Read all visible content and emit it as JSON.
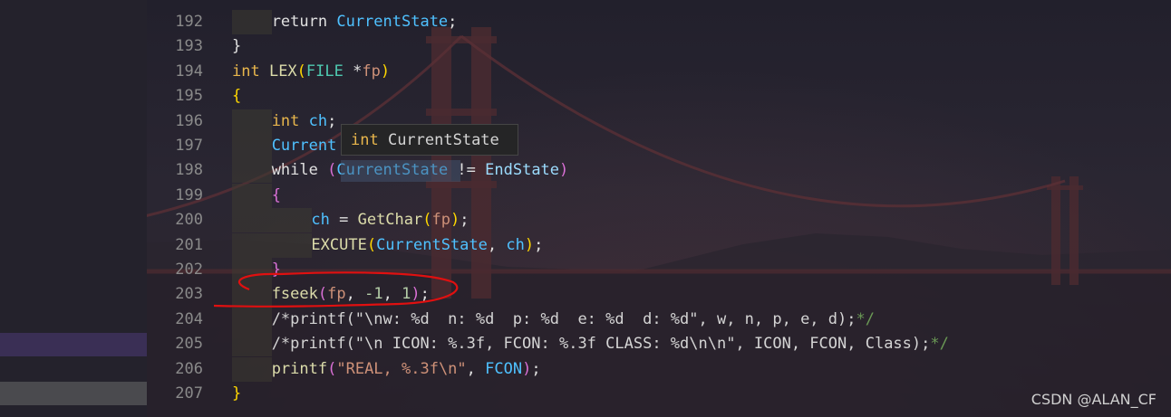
{
  "editor": {
    "lines": [
      {
        "num": "192",
        "tokens": [
          {
            "t": "return ",
            "c": "ctl"
          },
          {
            "t": "CurrentState",
            "c": "var"
          },
          {
            "t": ";",
            "c": "ctl"
          }
        ]
      },
      {
        "num": "193",
        "tokens": [
          {
            "t": "}",
            "c": "ctl"
          }
        ]
      },
      {
        "num": "194",
        "tokens": [
          {
            "t": "int ",
            "c": "kw"
          },
          {
            "t": "LEX",
            "c": "fn"
          },
          {
            "t": "(",
            "c": "yellow"
          },
          {
            "t": "FILE ",
            "c": "type"
          },
          {
            "t": "*",
            "c": "ctl"
          },
          {
            "t": "fp",
            "c": "str"
          },
          {
            "t": ")",
            "c": "yellow"
          }
        ]
      },
      {
        "num": "195",
        "tokens": [
          {
            "t": "{",
            "c": "yellow"
          }
        ]
      },
      {
        "num": "196",
        "tokens": [
          {
            "t": "int ",
            "c": "kw"
          },
          {
            "t": "ch",
            "c": "var"
          },
          {
            "t": ";",
            "c": "ctl"
          }
        ]
      },
      {
        "num": "197",
        "tokens": [
          {
            "t": "Current",
            "c": "var"
          }
        ]
      },
      {
        "num": "198",
        "tokens": [
          {
            "t": "while ",
            "c": "ctl"
          },
          {
            "t": "(",
            "c": "magenta"
          },
          {
            "t": "CurrentState",
            "c": "var"
          },
          {
            "t": " != ",
            "c": "ctl"
          },
          {
            "t": "EndState",
            "c": "param"
          },
          {
            "t": ")",
            "c": "magenta"
          }
        ]
      },
      {
        "num": "199",
        "tokens": [
          {
            "t": "{",
            "c": "magenta"
          }
        ]
      },
      {
        "num": "200",
        "tokens": [
          {
            "t": "ch",
            "c": "var"
          },
          {
            "t": " = ",
            "c": "ctl"
          },
          {
            "t": "GetChar",
            "c": "fn"
          },
          {
            "t": "(",
            "c": "yellow"
          },
          {
            "t": "fp",
            "c": "str"
          },
          {
            "t": ")",
            "c": "yellow"
          },
          {
            "t": ";",
            "c": "ctl"
          }
        ]
      },
      {
        "num": "201",
        "tokens": [
          {
            "t": "EXCUTE",
            "c": "fn"
          },
          {
            "t": "(",
            "c": "yellow"
          },
          {
            "t": "CurrentState",
            "c": "var"
          },
          {
            "t": ", ",
            "c": "ctl"
          },
          {
            "t": "ch",
            "c": "var"
          },
          {
            "t": ")",
            "c": "yellow"
          },
          {
            "t": ";",
            "c": "ctl"
          }
        ]
      },
      {
        "num": "202",
        "tokens": [
          {
            "t": "}",
            "c": "magenta"
          }
        ]
      },
      {
        "num": "203",
        "tokens": [
          {
            "t": "fseek",
            "c": "fn"
          },
          {
            "t": "(",
            "c": "magenta"
          },
          {
            "t": "fp",
            "c": "str"
          },
          {
            "t": ", ",
            "c": "ctl"
          },
          {
            "t": "-1",
            "c": "num"
          },
          {
            "t": ", ",
            "c": "ctl"
          },
          {
            "t": "1",
            "c": "num"
          },
          {
            "t": ")",
            "c": "magenta"
          },
          {
            "t": ";",
            "c": "ctl"
          }
        ]
      },
      {
        "num": "204",
        "tokens": [
          {
            "t": "/*printf(\"\\nw: %d  n: %d  p: %d  e: %d  d: %d\", w, n, p, e, d);",
            "c": "cmt"
          },
          {
            "t": "*/",
            "c": "cmtslash"
          }
        ]
      },
      {
        "num": "205",
        "tokens": [
          {
            "t": "/*printf(\"\\n ICON: %.3f, FCON: %.3f CLASS: %d\\n\\n\", ICON, FCON, Class);",
            "c": "cmt"
          },
          {
            "t": "*/",
            "c": "cmtslash"
          }
        ]
      },
      {
        "num": "206",
        "tokens": [
          {
            "t": "printf",
            "c": "fn"
          },
          {
            "t": "(",
            "c": "magenta"
          },
          {
            "t": "\"REAL, %.3f\\n\"",
            "c": "str"
          },
          {
            "t": ", ",
            "c": "ctl"
          },
          {
            "t": "FCON",
            "c": "var"
          },
          {
            "t": ")",
            "c": "magenta"
          },
          {
            "t": ";",
            "c": "ctl"
          }
        ]
      },
      {
        "num": "207",
        "tokens": [
          {
            "t": "}",
            "c": "yellow"
          }
        ]
      }
    ],
    "tooltip": {
      "keyword": "int",
      "name": " CurrentState"
    }
  },
  "watermark": "CSDN @ALAN_CF",
  "annotation": {
    "color": "#e01010"
  }
}
